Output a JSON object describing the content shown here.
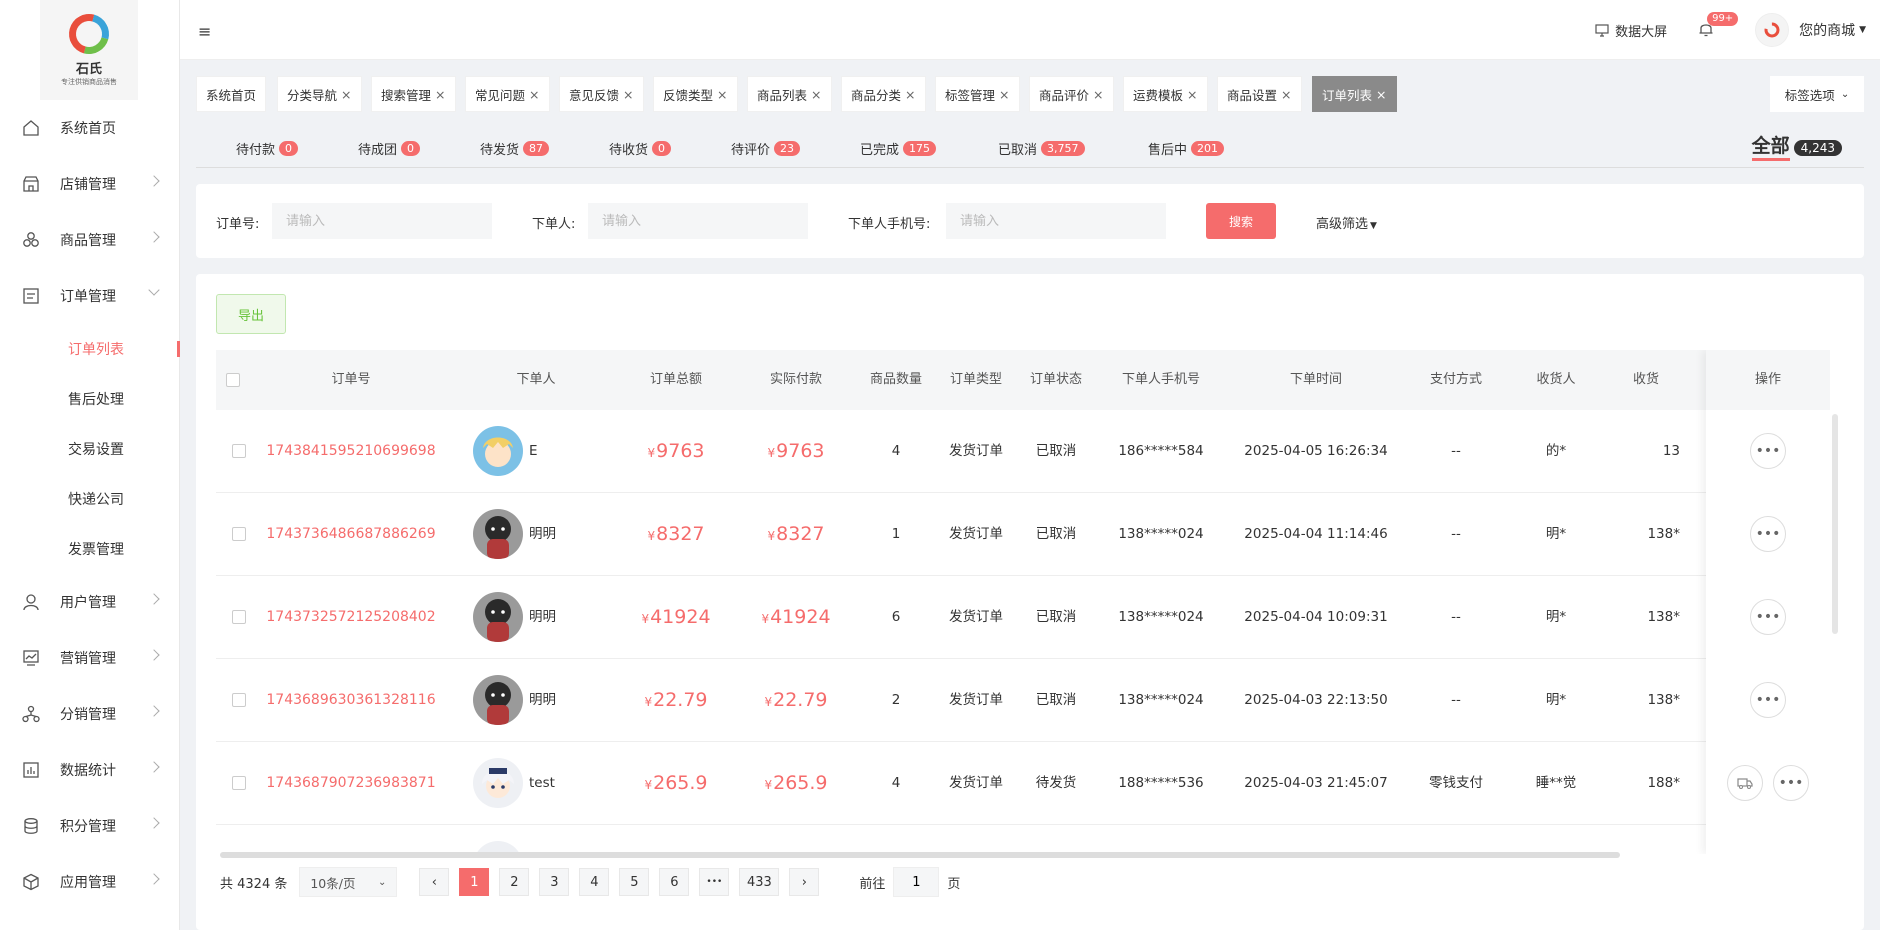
{
  "logo": {
    "name": "石氏",
    "tagline": "专注供销商品消售"
  },
  "menu": [
    {
      "label": "系统首页",
      "icon": "home-icon",
      "arrow": false
    },
    {
      "label": "店铺管理",
      "icon": "shop-icon",
      "arrow": true
    },
    {
      "label": "商品管理",
      "icon": "goods-icon",
      "arrow": true
    },
    {
      "label": "订单管理",
      "icon": "order-icon",
      "arrow": true,
      "expanded": true
    }
  ],
  "submenu": [
    "订单列表",
    "售后处理",
    "交易设置",
    "快递公司",
    "发票管理"
  ],
  "menu2": [
    {
      "label": "用户管理",
      "icon": "user-icon"
    },
    {
      "label": "营销管理",
      "icon": "marketing-icon"
    },
    {
      "label": "分销管理",
      "icon": "distribution-icon"
    },
    {
      "label": "数据统计",
      "icon": "chart-icon"
    },
    {
      "label": "积分管理",
      "icon": "points-icon"
    },
    {
      "label": "应用管理",
      "icon": "app-icon"
    }
  ],
  "topbar": {
    "screen": "数据大屏",
    "notifications": "99+",
    "shop": "您的商城"
  },
  "tags": [
    "系统首页",
    "分类导航",
    "搜索管理",
    "常见问题",
    "意见反馈",
    "反馈类型",
    "商品列表",
    "商品分类",
    "标签管理",
    "商品评价",
    "运费模板",
    "商品设置",
    "订单列表"
  ],
  "tag_options": "标签选项",
  "statuses": [
    {
      "label": "待付款",
      "count": "0"
    },
    {
      "label": "待成团",
      "count": "0"
    },
    {
      "label": "待发货",
      "count": "87"
    },
    {
      "label": "待收货",
      "count": "0"
    },
    {
      "label": "待评价",
      "count": "23"
    },
    {
      "label": "已完成",
      "count": "175"
    },
    {
      "label": "已取消",
      "count": "3,757"
    },
    {
      "label": "售后中",
      "count": "201"
    }
  ],
  "all": {
    "label": "全部",
    "count": "4,243"
  },
  "filter": {
    "order_no_label": "订单号:",
    "buyer_label": "下单人:",
    "phone_label": "下单人手机号:",
    "placeholder": "请输入",
    "search": "搜索",
    "advanced": "高级筛选"
  },
  "export": "导出",
  "columns": [
    "订单号",
    "下单人",
    "订单总额",
    "实际付款",
    "商品数量",
    "订单类型",
    "订单状态",
    "下单人手机号",
    "下单时间",
    "支付方式",
    "收货人",
    "收货",
    "操作"
  ],
  "currency": "¥",
  "rows": [
    {
      "order_no": "1743841595210699698",
      "buyer": "E",
      "total": "9763",
      "paid": "9763",
      "qty": "4",
      "type": "发货订单",
      "status": "已取消",
      "phone": "186*****584",
      "time": "2025-04-05 16:26:34",
      "pay": "--",
      "receiver": "的*",
      "rphone": "13",
      "avatar": "blonde"
    },
    {
      "order_no": "1743736486687886269",
      "buyer": "明明",
      "total": "8327",
      "paid": "8327",
      "qty": "1",
      "type": "发货订单",
      "status": "已取消",
      "phone": "138*****024",
      "time": "2025-04-04 11:14:46",
      "pay": "--",
      "receiver": "明*",
      "rphone": "138*",
      "avatar": "dark"
    },
    {
      "order_no": "1743732572125208402",
      "buyer": "明明",
      "total": "41924",
      "paid": "41924",
      "qty": "6",
      "type": "发货订单",
      "status": "已取消",
      "phone": "138*****024",
      "time": "2025-04-04 10:09:31",
      "pay": "--",
      "receiver": "明*",
      "rphone": "138*",
      "avatar": "dark"
    },
    {
      "order_no": "1743689630361328116",
      "buyer": "明明",
      "total": "22.79",
      "paid": "22.79",
      "qty": "2",
      "type": "发货订单",
      "status": "已取消",
      "phone": "138*****024",
      "time": "2025-04-03 22:13:50",
      "pay": "--",
      "receiver": "明*",
      "rphone": "138*",
      "avatar": "dark"
    },
    {
      "order_no": "1743687907236983871",
      "buyer": "test",
      "total": "265.9",
      "paid": "265.9",
      "qty": "4",
      "type": "发货订单",
      "status": "待发货",
      "phone": "188*****536",
      "time": "2025-04-03 21:45:07",
      "pay": "零钱支付",
      "receiver": "睡**觉",
      "rphone": "188*",
      "avatar": "white",
      "ship": true
    }
  ],
  "pager": {
    "total": "共 4324 条",
    "size": "10条/页",
    "pages": [
      "1",
      "2",
      "3",
      "4",
      "5",
      "6",
      "•••",
      "433"
    ],
    "goto": "前往",
    "goto_val": "1",
    "page_suffix": "页"
  }
}
